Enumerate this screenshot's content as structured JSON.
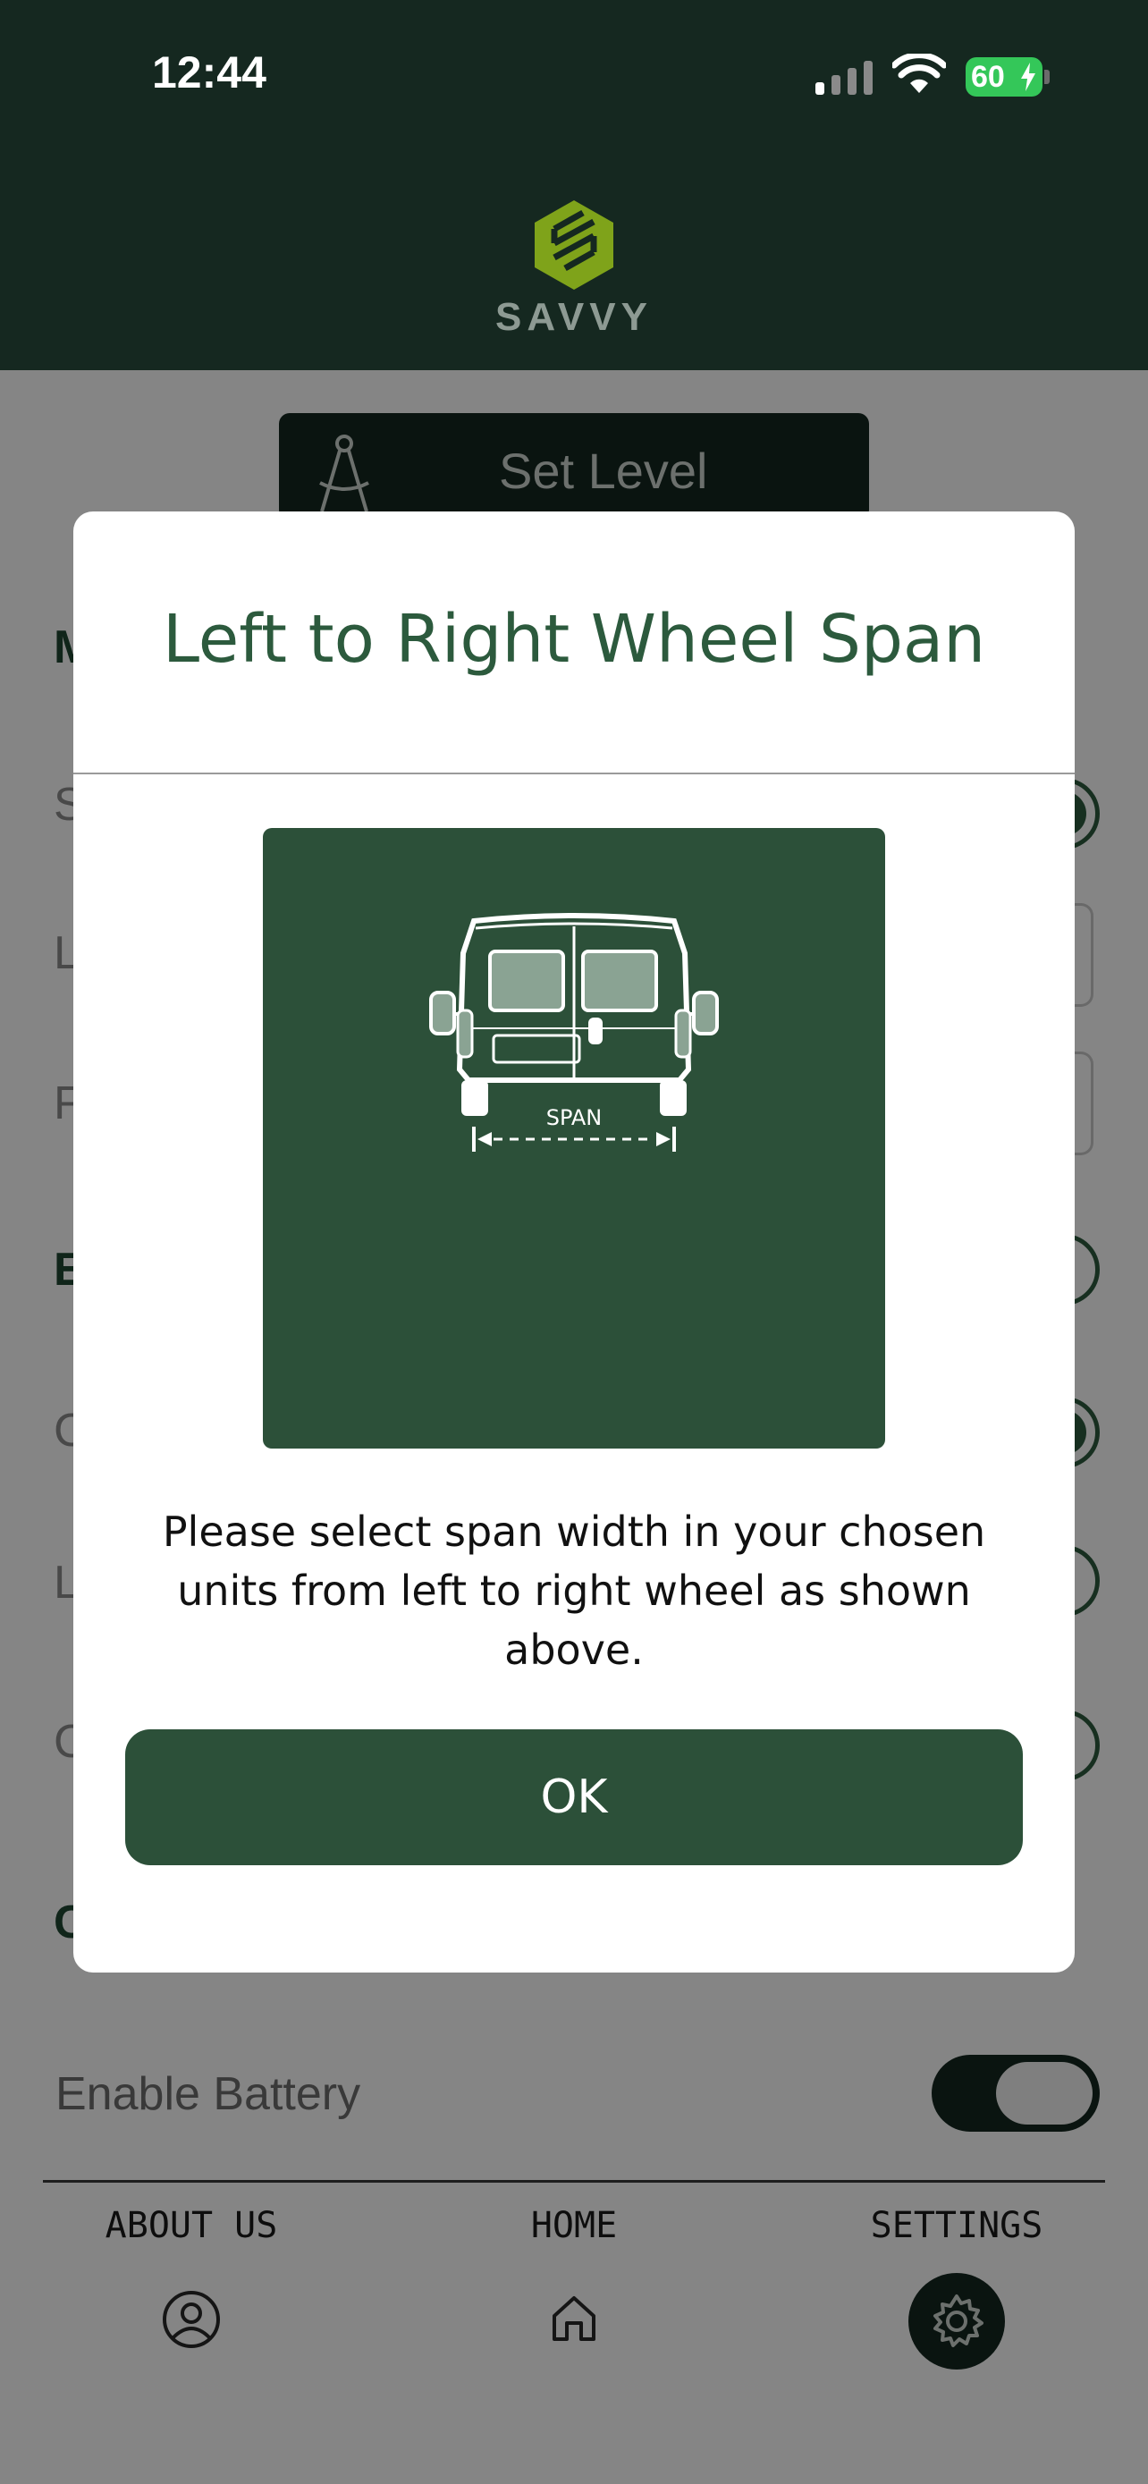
{
  "status_bar": {
    "time": "12:44",
    "battery": "60"
  },
  "header": {
    "brand": "SAVVY"
  },
  "page": {
    "set_level_label": "Set Level",
    "enable_battery_label": "Enable Battery"
  },
  "tabs": [
    {
      "label": "ABOUT US",
      "icon": "user-icon"
    },
    {
      "label": "HOME",
      "icon": "home-icon"
    },
    {
      "label": "SETTINGS",
      "icon": "gear-icon"
    }
  ],
  "modal": {
    "title": "Left to Right Wheel Span",
    "span_label": "SPAN",
    "message": "Please select span width in your chosen units from left to right wheel as shown above.",
    "ok_label": "OK"
  },
  "colors": {
    "header_bg": "#152820",
    "accent": "#2c5039",
    "title": "#2c5a3d",
    "logo_green": "#7fa31a"
  }
}
